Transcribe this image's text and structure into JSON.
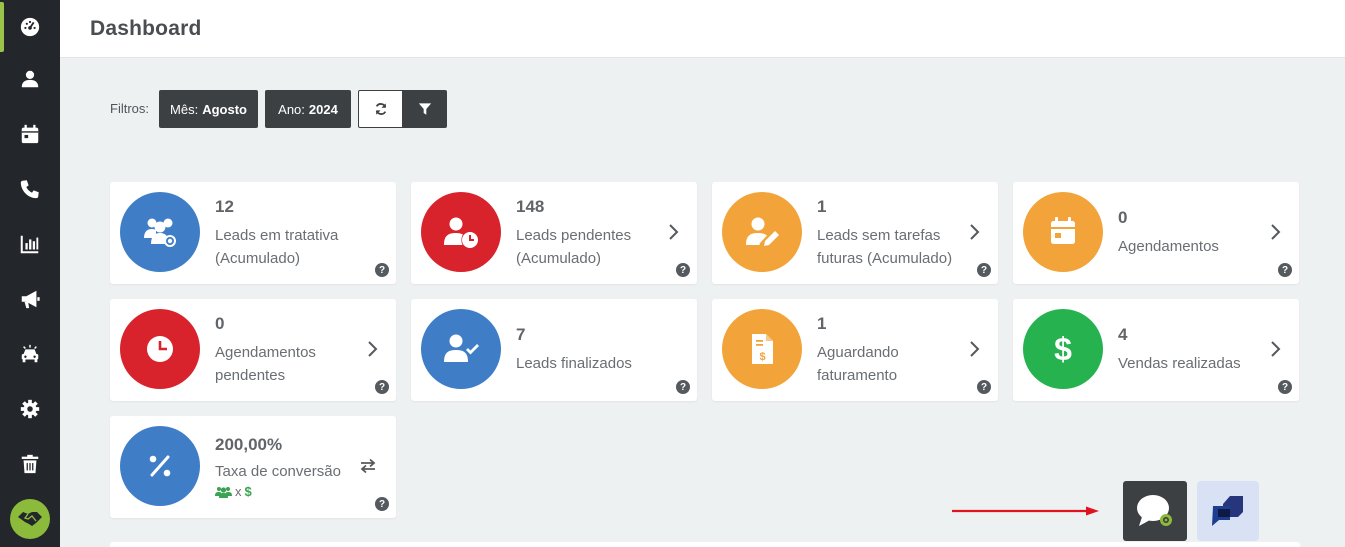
{
  "header": {
    "title": "Dashboard"
  },
  "sidebar": {
    "items": [
      {
        "icon": "speedometer-icon",
        "active": true
      },
      {
        "icon": "user-icon"
      },
      {
        "icon": "calendar-icon"
      },
      {
        "icon": "phone-icon"
      },
      {
        "icon": "bar-chart-icon"
      },
      {
        "icon": "megaphone-icon"
      },
      {
        "icon": "car-icon"
      },
      {
        "icon": "gear-icon"
      },
      {
        "icon": "trash-icon"
      }
    ],
    "bottom_icon": "handshake-icon",
    "accent": "#9bc24a"
  },
  "filters": {
    "label": "Filtros:",
    "month_label": "Mês:",
    "month_value": "Agosto",
    "year_label": "Ano:",
    "year_value": "2024",
    "refresh_icon": "refresh-icon",
    "filter_icon": "filter-icon"
  },
  "cards": [
    {
      "value": "12",
      "label": "Leads em tratativa (Acumulado)",
      "color": "#3f7ec7",
      "icon": "users-gear-icon"
    },
    {
      "value": "148",
      "label": "Leads pendentes (Acumulado)",
      "color": "#d8232c",
      "icon": "user-clock-icon"
    },
    {
      "value": "1",
      "label": "Leads sem tarefas futuras (Acumulado)",
      "color": "#f2a43a",
      "icon": "user-edit-icon"
    },
    {
      "value": "0",
      "label": "Agendamentos",
      "color": "#f2a43a",
      "icon": "calendar-icon"
    },
    {
      "value": "0",
      "label": "Agendamentos pendentes",
      "color": "#d8232c",
      "icon": "clock-icon"
    },
    {
      "value": "7",
      "label": "Leads finalizados",
      "color": "#3f7ec7",
      "icon": "user-check-icon"
    },
    {
      "value": "1",
      "label": "Aguardando faturamento",
      "color": "#f2a43a",
      "icon": "invoice-icon"
    },
    {
      "value": "4",
      "label": "Vendas realizadas",
      "color": "#26b34f",
      "icon": "dollar-icon"
    }
  ],
  "conversion": {
    "value": "200,00%",
    "label": "Taxa de conversão",
    "sub_sep": "x",
    "sub_currency": "$",
    "color": "#3f7ec7",
    "icon": "percent-icon"
  },
  "help_glyph": "?",
  "floating": {
    "chat_icon": "chat-icon",
    "widget_icon": "chat-widget-icon",
    "annotation_color": "#e0141c"
  }
}
